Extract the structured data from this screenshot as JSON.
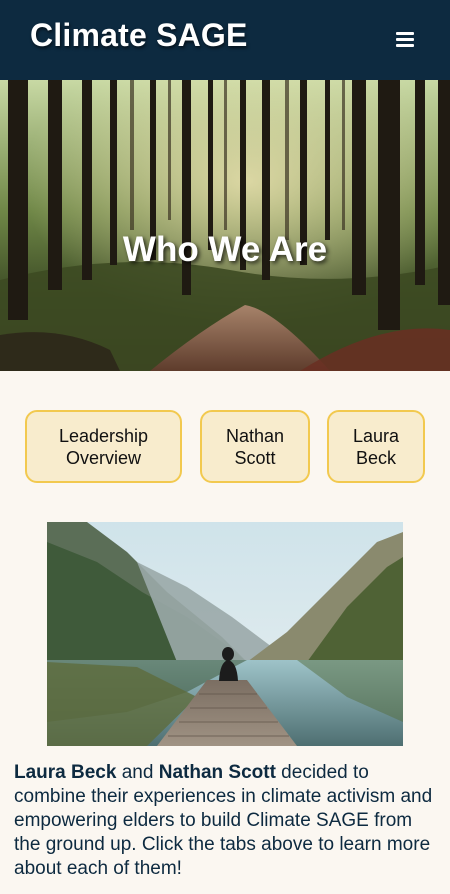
{
  "header": {
    "brand": "Climate SAGE",
    "menu_icon": "hamburger-menu-icon"
  },
  "hero": {
    "title": "Who We Are",
    "image": "forest-path"
  },
  "tabs": [
    {
      "label_line1": "Leadership",
      "label_line2": "Overview"
    },
    {
      "label_line1": "Nathan",
      "label_line2": "Scott"
    },
    {
      "label_line1": "Laura",
      "label_line2": "Beck"
    }
  ],
  "photo": {
    "image": "person-on-dock-mountain-lake"
  },
  "intro": {
    "name1": "Laura Beck",
    "conj": " and ",
    "name2": "Nathan Scott",
    "text": " decided to combine their experiences in climate activism and empowering elders to build Climate SAGE from the ground up. Click the tabs above to learn more about each of them!"
  },
  "colors": {
    "header_bg": "#0d2a40",
    "page_bg": "#fbf7f1",
    "tab_bg": "#f8eccd",
    "tab_border": "#f2c94f",
    "text": "#0d2a40"
  }
}
